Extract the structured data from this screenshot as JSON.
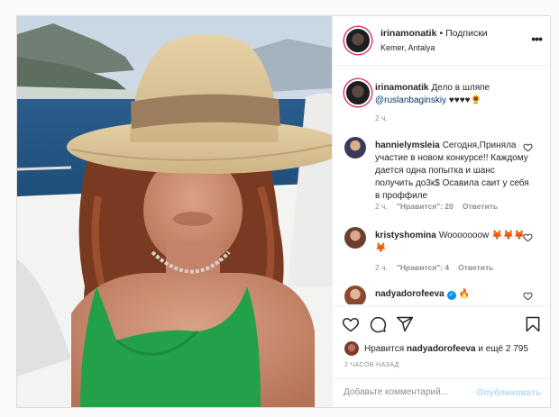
{
  "colors": {
    "accent": "#0095f6",
    "muted": "#8e8e8e",
    "text": "#262626",
    "swimsuit": "#22a148"
  },
  "post": {
    "image_alt": "Woman in straw hat and green swimsuit on a yacht",
    "author": "irinamonatik",
    "separator": "•",
    "follow_label": "Подписки",
    "location": "Kemer, Antalya",
    "more_icon": "more-horizontal-icon"
  },
  "caption": {
    "user": "irinamonatik",
    "text": "Дело в шляпе",
    "mention": "@ruslanbaginskiy",
    "emoji": "♥♥♥♥🌻",
    "time": "2 ч."
  },
  "comments": [
    {
      "user": "hannielymsleia",
      "text": "Сегодня,Приняла участие в новом конкурсе!! Каждому дается одна попытка и шанс получить до3к$ Осавила саит у себя в проффиле",
      "time": "2 ч.",
      "likes": "\"Нравится\": 20",
      "reply": "Ответить"
    },
    {
      "user": "kristyshomina",
      "text": "Wooooooow 🦊🦊🦊🦊",
      "time": "2 ч.",
      "likes": "\"Нравится\": 4",
      "reply": "Ответить"
    },
    {
      "user": "nadyadorofeeva",
      "text": "🔥",
      "verified": true
    }
  ],
  "actions": {
    "like_icon": "heart-icon",
    "comment_icon": "comment-icon",
    "share_icon": "share-icon",
    "save_icon": "bookmark-icon"
  },
  "likes": {
    "prefix": "Нравится",
    "user": "nadyadorofeeva",
    "suffix": "и ещё 2 795"
  },
  "timestamp": "2 ЧАСОВ НАЗАД",
  "add_comment": {
    "placeholder": "Добавьте комментарий...",
    "post_label": "Опубликовать"
  }
}
